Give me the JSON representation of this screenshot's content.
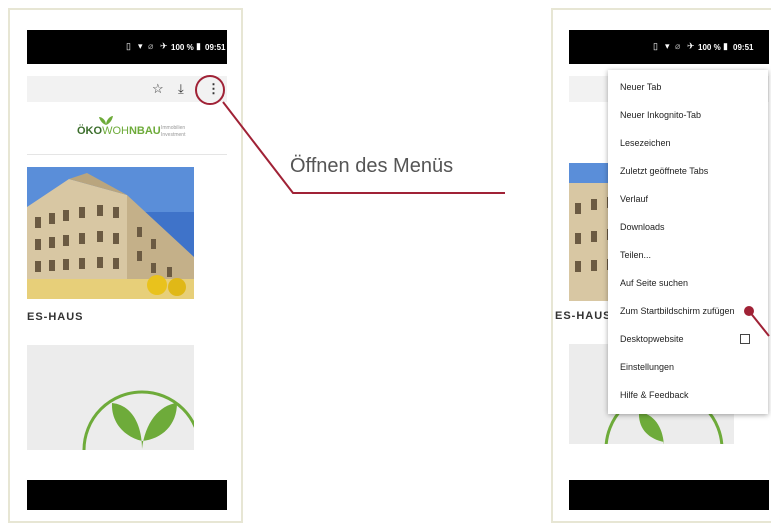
{
  "status_bar": {
    "battery": "100 %",
    "time": "09:51"
  },
  "logo": {
    "brand_part1": "ÖKO",
    "brand_part2": "WO",
    "brand_part3": "H",
    "brand_part4": "NBAU",
    "tagline_line1": "Immobilien",
    "tagline_line2": "Investment"
  },
  "website": {
    "heading_partial": "ES-HAUS"
  },
  "callout": {
    "label": "Öffnen des Menüs"
  },
  "menu": {
    "items": [
      "Neuer Tab",
      "Neuer Inkognito-Tab",
      "Lesezeichen",
      "Zuletzt geöffnete Tabs",
      "Verlauf",
      "Downloads",
      "Teilen...",
      "Auf Seite suchen",
      "Zum Startbildschirm zufügen",
      "Desktopwebsite",
      "Einstellungen",
      "Hilfe & Feedback"
    ]
  },
  "colors": {
    "frame_border": "#e7e6d4",
    "highlight": "#a02236",
    "logo_green": "#6eab3a",
    "logo_dark": "#3c6e2c",
    "statusbar": "#000000"
  },
  "icons": [
    "vibrate-icon",
    "wifi-icon",
    "no-sim-icon",
    "airplane-icon",
    "battery-icon",
    "star-icon",
    "download-icon",
    "menu-dots-icon",
    "checkbox-icon"
  ]
}
